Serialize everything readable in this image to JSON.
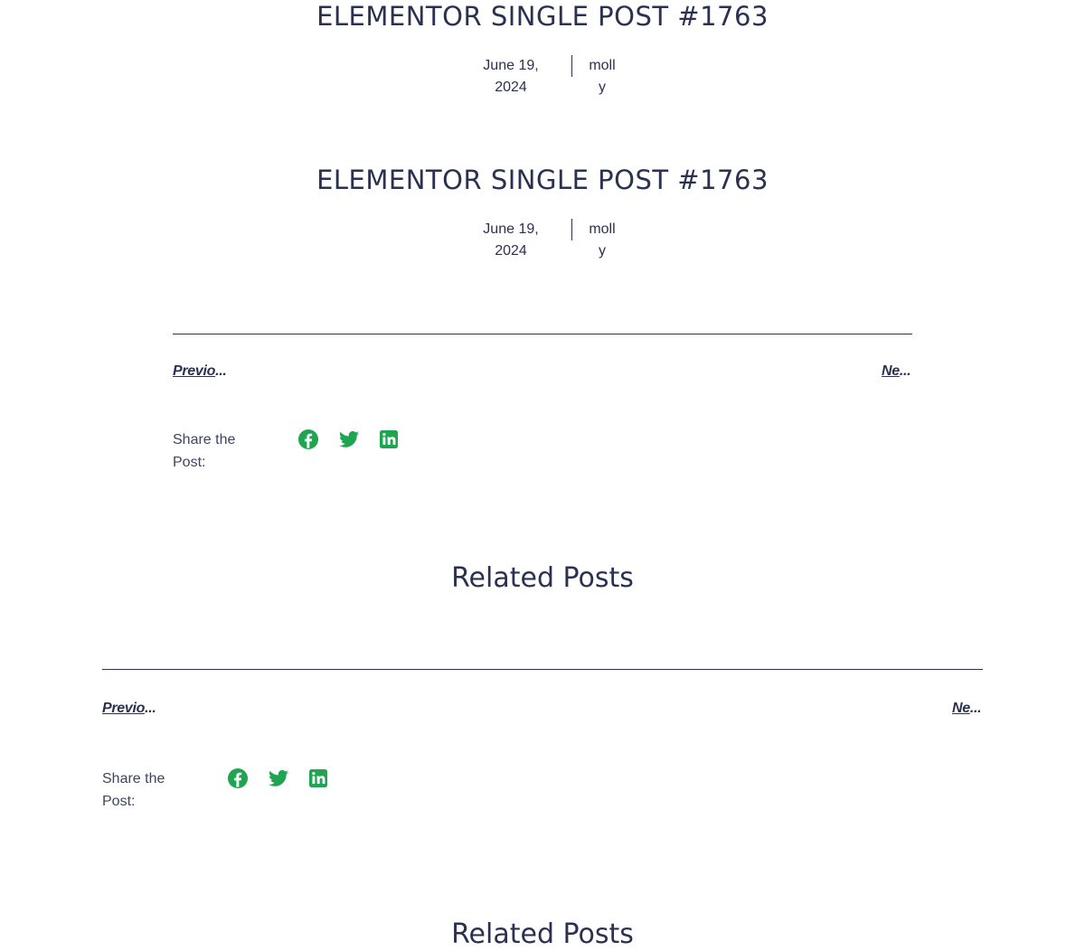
{
  "posts": [
    {
      "title": "ELEMENTOR SINGLE POST #1763",
      "date_line1": "June 19,",
      "date_line2": "2024",
      "author_line1": "moll",
      "author_line2": "y"
    },
    {
      "title": "ELEMENTOR SINGLE POST #1763",
      "date_line1": "June 19,",
      "date_line2": "2024",
      "author_line1": "moll",
      "author_line2": "y"
    }
  ],
  "post_nav": [
    {
      "previous_label": "Previo",
      "next_label": "Ne",
      "ellipsis": "..."
    },
    {
      "previous_label": "Previo",
      "next_label": "Ne",
      "ellipsis": "..."
    }
  ],
  "share": {
    "label_line1": "Share the",
    "label_line2": "Post:",
    "icons": [
      "facebook-icon",
      "twitter-icon",
      "linkedin-icon"
    ],
    "icon_color": "#1fa552"
  },
  "related": {
    "title": "Related Posts"
  },
  "colors": {
    "text": "#2b3150",
    "accent": "#1fa552",
    "background": "#ffffff"
  }
}
